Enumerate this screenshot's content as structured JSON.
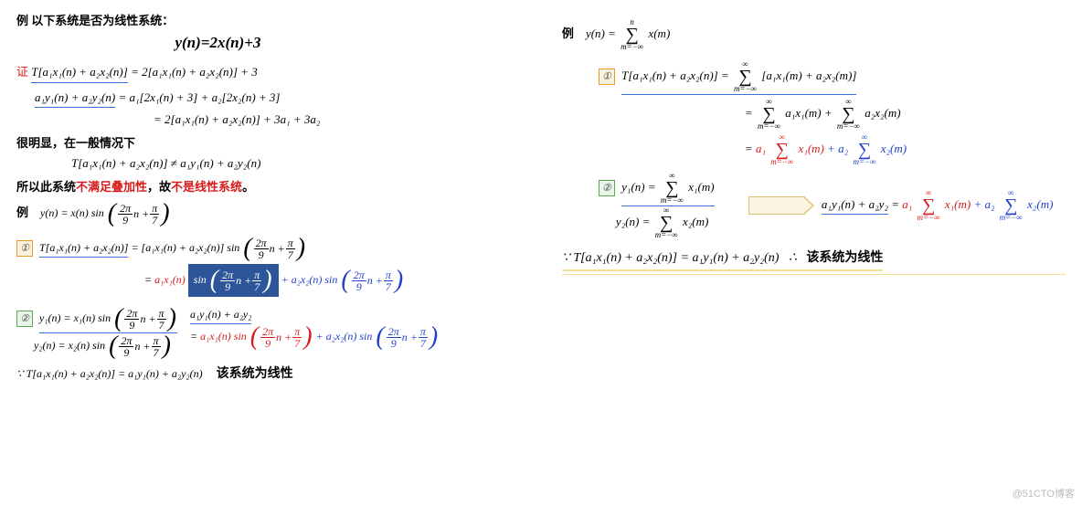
{
  "left": {
    "ex_label": "例",
    "ex_title": "以下系统是否为线性系统：",
    "main_formula_y": "y(n)",
    "main_formula_eq": "=",
    "main_formula_2x": "2x(n)",
    "main_formula_p3": "+3",
    "proof_label": "证",
    "eq1_lhs": "T[a₁x₁(n) + a₂x₂(n)]",
    "eq1_rhs": " = 2[a₁x₁(n) + a₂x₂(n)] + 3",
    "eq2_lhs": "a₁y₁(n) + a₂y₂(n)",
    "eq2_rhs": " = a₁[2x₁(n) + 3] + a₂[2x₂(n) + 3]",
    "eq3": "= 2[a₁x₁(n) + a₂x₂(n)] + 3a₁ + 3a₂",
    "obvious": "很明显，在一般情况下",
    "neq": "T[a₁x₁(n) + a₂x₂(n)] ≠ a₁y₁(n) + a₂y₂(n)",
    "conc1_a": "所以此系统",
    "conc1_b": "不满足叠加性",
    "conc1_c": "，故",
    "conc1_d": "不是线性系统",
    "conc1_e": "。",
    "ex2_label": "例",
    "eq_sin_y": "y(n) = x(n) sin",
    "frac_2pi": "2π",
    "frac_9": "9",
    "n_plus": "n +",
    "frac_pi": "π",
    "frac_7": "7",
    "step1_lhs": "T[a₁x₁(n) + a₂x₂(n)]",
    "step1_rhs": " = [a₁x₁(n) + a₂x₂(n)] sin",
    "eq_mid": "=",
    "term_a1x1": "a₁x₁(n)",
    "sin": "sin",
    "plus": "+",
    "term_a2x2": "a₂x₂(n)",
    "y1_def": "y₁(n) = x₁(n) sin",
    "y2_def": "y₂(n) = x₂(n) sin",
    "rhs_combo": "a₁y₁(n) + a₂y₂",
    "because": "∵",
    "final_eq": "T[a₁x₁(n) + a₂x₂(n)] = a₁y₁(n) + a₂y₂(n)",
    "conc2": "该系统为线性",
    "one": "①",
    "two": "②"
  },
  "right": {
    "ex_label": "例",
    "main_y": "y(n) = ",
    "sum_top": "n",
    "sum_bot": "m=−∞",
    "sum_body": "x(m)",
    "step1_lhs": "T[a₁x₁(n) + a₂x₂(n)] = ",
    "sum_top_inf": "∞",
    "body1": "[a₁x₁(m) + a₂x₂(m)]",
    "eq": "=",
    "a1": "a₁",
    "a2": "a₂",
    "x1m": "x₁(m)",
    "x2m": "x₂(m)",
    "a1x1m": "a₁x₁(m)",
    "a2x2m": "a₂x₂(m)",
    "plus": "+",
    "y1_def": "y₁(n) = ",
    "y2_def": "y₂(n) = ",
    "sum_body_x1": "x₁(m)",
    "sum_body_x2": "x₂(m)",
    "combo_lhs": "a₁y₁(n) + a₂y₂",
    "combo_eq": " = ",
    "because": "∵",
    "therefore": "∴",
    "final": "T[a₁x₁(n) + a₂x₂(n)] = a₁y₁(n) + a₂y₂(n)",
    "conc": "该系统为线性",
    "one": "①",
    "two": "②"
  },
  "watermark": "@51CTO博客"
}
